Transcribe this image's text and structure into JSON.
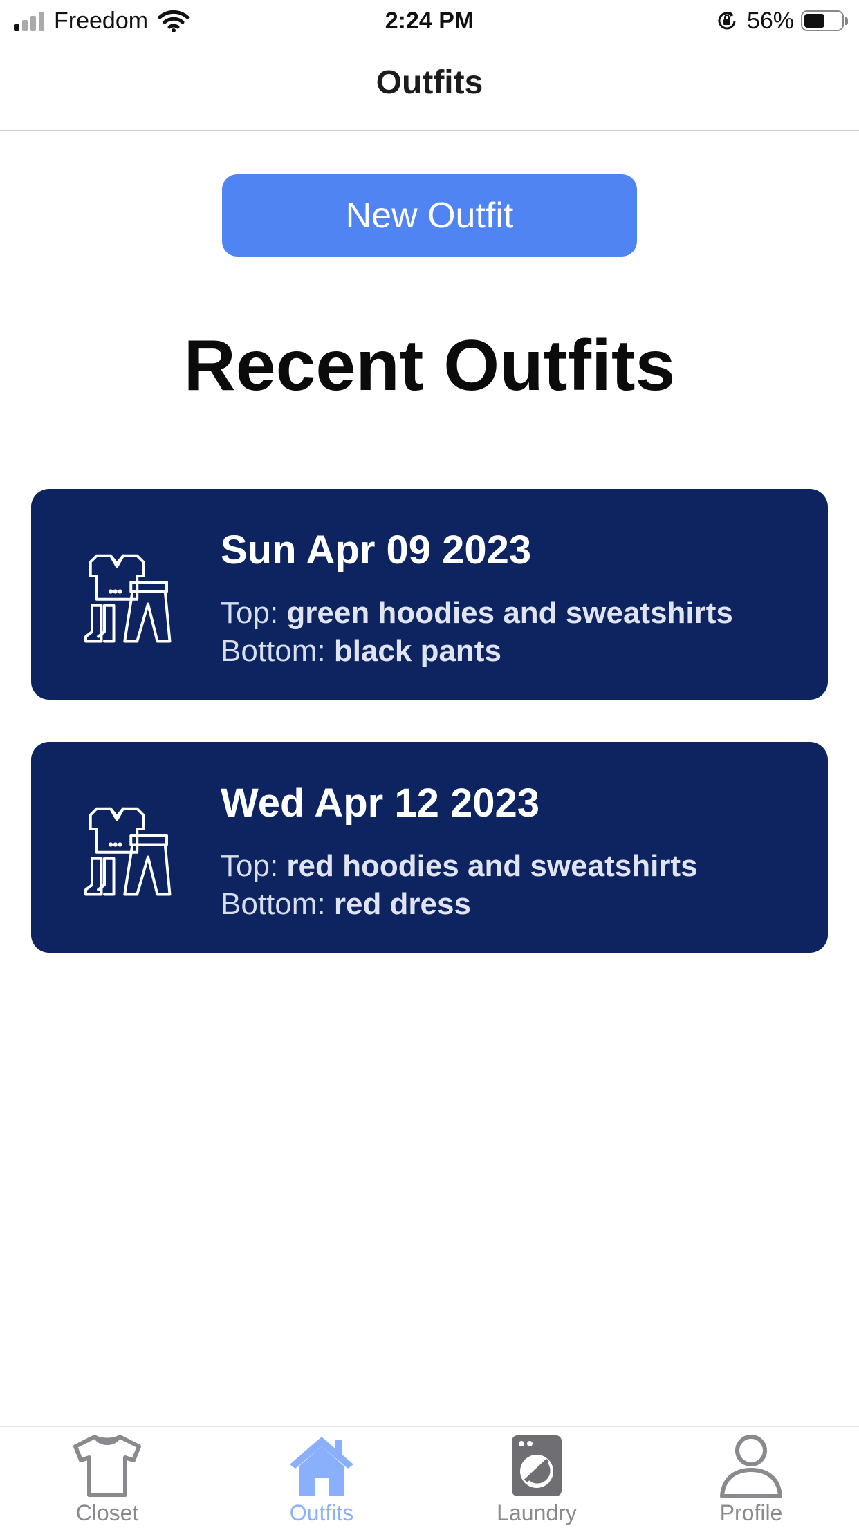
{
  "status_bar": {
    "carrier": "Freedom",
    "time": "2:24 PM",
    "battery_percent": "56%",
    "battery_level": 0.56
  },
  "nav": {
    "title": "Outfits"
  },
  "actions": {
    "new_outfit_label": "New Outfit"
  },
  "section": {
    "title": "Recent Outfits"
  },
  "outfits": [
    {
      "date": "Sun Apr 09 2023",
      "top_prefix": "Top: ",
      "top": "green hoodies and sweatshirts",
      "bottom_prefix": "Bottom: ",
      "bottom": "black pants",
      "icon": "clothes-icon"
    },
    {
      "date": "Wed Apr 12 2023",
      "top_prefix": "Top: ",
      "top": "red hoodies and sweatshirts",
      "bottom_prefix": "Bottom: ",
      "bottom": "red dress",
      "icon": "clothes-icon"
    }
  ],
  "tab_bar": {
    "items": [
      {
        "label": "Closet",
        "icon": "tshirt-icon"
      },
      {
        "label": "Outfits",
        "icon": "house-icon",
        "active": true
      },
      {
        "label": "Laundry",
        "icon": "washing-machine-icon"
      },
      {
        "label": "Profile",
        "icon": "person-icon"
      }
    ]
  },
  "colors": {
    "primary_button": "#4f84f2",
    "card_background": "#0d2461",
    "active_tab": "#8ab0fb",
    "inactive_tab": "#8a8a8e"
  }
}
